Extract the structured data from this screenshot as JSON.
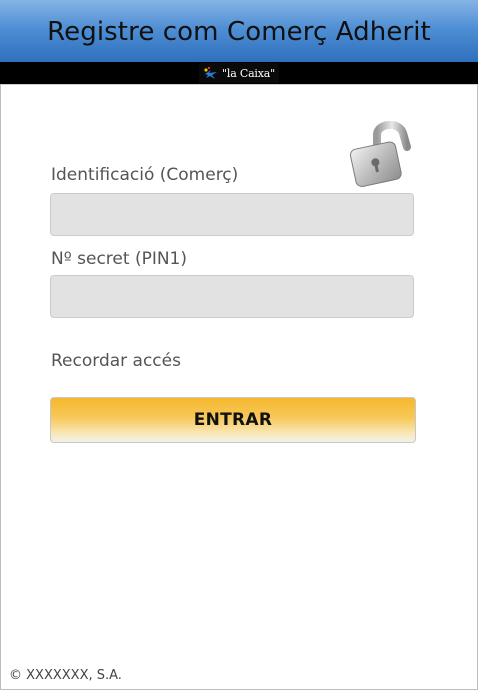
{
  "header": {
    "title": "Registre com Comerç Adherit"
  },
  "brand": {
    "logo_text": "\"la Caixa\"",
    "star_color": "#2a7fd4"
  },
  "form": {
    "id_label": "Identificació (Comerç)",
    "id_value": "",
    "pin_label": "Nº secret (PIN1)",
    "pin_value": "",
    "remember_label": "Recordar accés",
    "submit_label": "ENTRAR"
  },
  "footer": {
    "copyright": "© XXXXXXX, S.A."
  },
  "colors": {
    "header_blue": "#4f8fd4",
    "button_yellow": "#f6b82d",
    "field_gray": "#e2e2e2"
  }
}
